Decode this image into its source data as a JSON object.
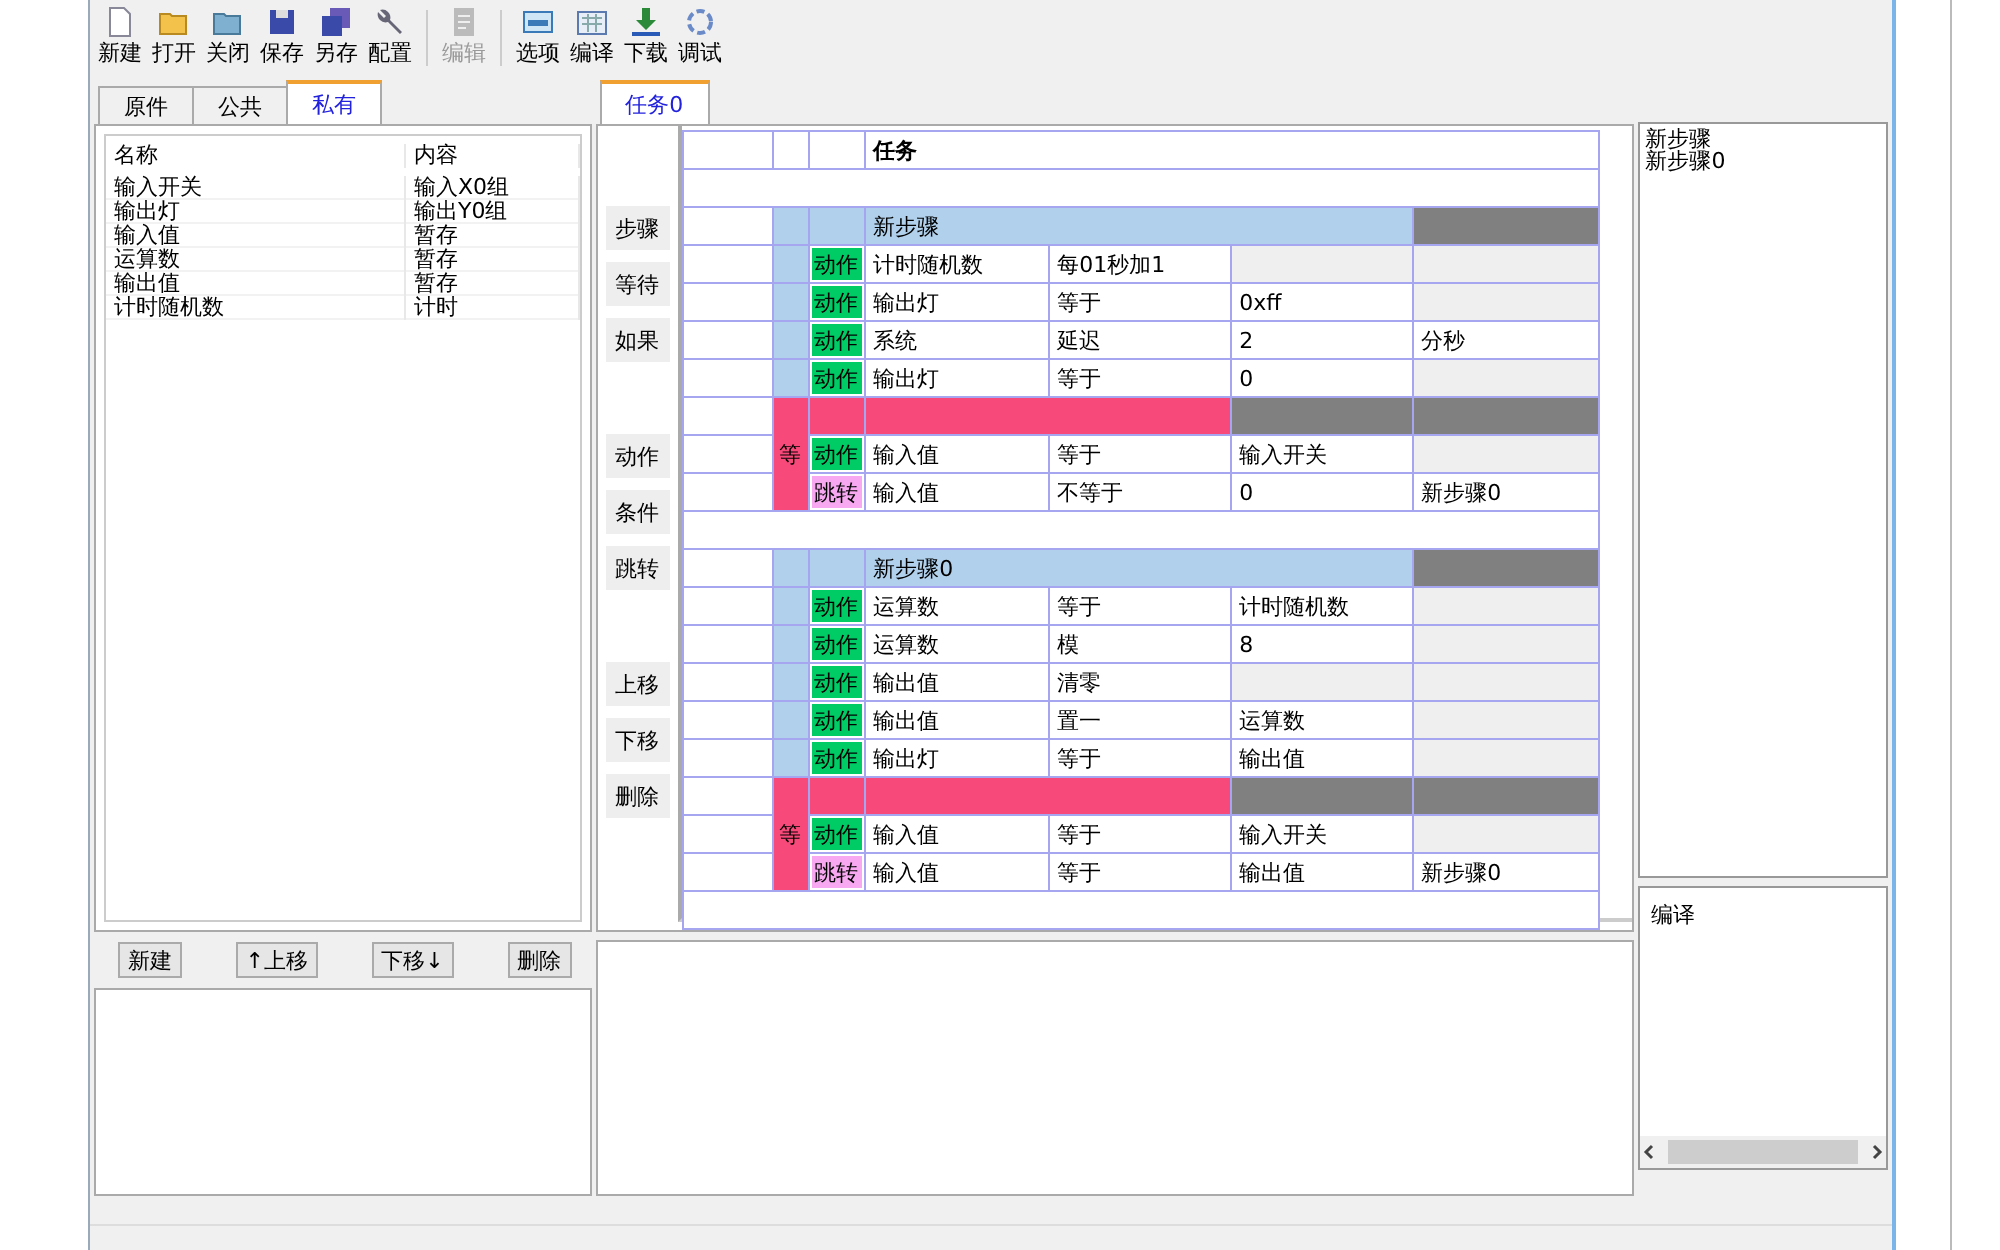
{
  "toolbar": [
    [
      {
        "label": "新建",
        "disabled": false
      },
      {
        "label": "打开",
        "disabled": false
      },
      {
        "label": "关闭",
        "disabled": false
      },
      {
        "label": "保存",
        "disabled": false
      },
      {
        "label": "另存",
        "disabled": false
      },
      {
        "label": "配置",
        "disabled": false
      }
    ],
    [
      {
        "label": "编辑",
        "disabled": true
      }
    ],
    [
      {
        "label": "选项",
        "disabled": false
      },
      {
        "label": "编译",
        "disabled": false
      },
      {
        "label": "下载",
        "disabled": false
      },
      {
        "label": "调试",
        "disabled": false
      }
    ]
  ],
  "left_tabs": [
    {
      "label": "原件",
      "selected": false
    },
    {
      "label": "公共",
      "selected": false
    },
    {
      "label": "私有",
      "selected": true
    }
  ],
  "variables": {
    "columns": [
      "名称",
      "内容"
    ],
    "rows": [
      [
        "输入开关",
        "输入X0组"
      ],
      [
        "输出灯",
        "输出Y0组"
      ],
      [
        "输入值",
        "暂存"
      ],
      [
        "运算数",
        "暂存"
      ],
      [
        "输出值",
        "暂存"
      ],
      [
        "计时随机数",
        "计时"
      ]
    ]
  },
  "variable_buttons": [
    "新建",
    "↑上移",
    "下移↓",
    "删除"
  ],
  "task_tabs": [
    {
      "label": "任务0",
      "selected": true
    }
  ],
  "side_buttons": [
    [
      "步骤",
      "等待",
      "如果"
    ],
    [
      "动作",
      "条件",
      "跳转"
    ],
    [
      "上移",
      "下移",
      "删除"
    ]
  ],
  "program": {
    "title": "任务",
    "steps": [
      {
        "name": "新步骤",
        "actions": [
          {
            "kind": "action",
            "tag": "动作",
            "cells": [
              "计时随机数",
              "每01秒加1"
            ]
          },
          {
            "kind": "action",
            "tag": "动作",
            "cells": [
              "输出灯",
              "等于",
              "0xff"
            ]
          },
          {
            "kind": "action",
            "tag": "动作",
            "cells": [
              "系统",
              "延迟",
              "2",
              "分秒"
            ]
          },
          {
            "kind": "action",
            "tag": "动作",
            "cells": [
              "输出灯",
              "等于",
              "0"
            ]
          }
        ],
        "wait": {
          "label": "等",
          "conditions": [
            {
              "kind": "action",
              "tag": "动作",
              "cells": [
                "输入值",
                "等于",
                "输入开关"
              ]
            },
            {
              "kind": "jump",
              "tag": "跳转",
              "cells": [
                "输入值",
                "不等于",
                "0",
                "新步骤0"
              ]
            }
          ]
        }
      },
      {
        "name": "新步骤0",
        "actions": [
          {
            "kind": "action",
            "tag": "动作",
            "cells": [
              "运算数",
              "等于",
              "计时随机数"
            ]
          },
          {
            "kind": "action",
            "tag": "动作",
            "cells": [
              "运算数",
              "模",
              "8"
            ]
          },
          {
            "kind": "action",
            "tag": "动作",
            "cells": [
              "输出值",
              "清零"
            ]
          },
          {
            "kind": "action",
            "tag": "动作",
            "cells": [
              "输出值",
              "置一",
              "运算数"
            ]
          },
          {
            "kind": "action",
            "tag": "动作",
            "cells": [
              "输出灯",
              "等于",
              "输出值"
            ]
          }
        ],
        "wait": {
          "label": "等",
          "conditions": [
            {
              "kind": "action",
              "tag": "动作",
              "cells": [
                "输入值",
                "等于",
                "输入开关"
              ]
            },
            {
              "kind": "jump",
              "tag": "跳转",
              "cells": [
                "输入值",
                "等于",
                "输出值",
                "新步骤0"
              ]
            }
          ]
        }
      }
    ]
  },
  "step_list": [
    "新步骤",
    "新步骤0"
  ],
  "output": {
    "text": "编译"
  }
}
